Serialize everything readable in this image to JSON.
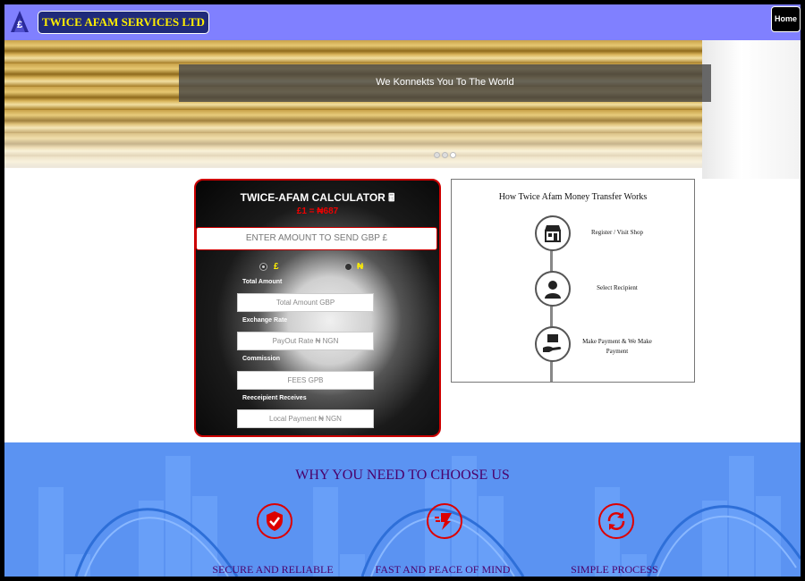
{
  "header": {
    "brand": "TWICE AFAM SERVICES LTD",
    "home_label": "Home",
    "logo_icon": "pound-logo-icon"
  },
  "hero": {
    "caption": "We Konnekts You To The World",
    "slide_count": 3,
    "active_slide": 3
  },
  "calculator": {
    "title": "TWICE-AFAM CALCULATOR 🖩",
    "rate": "£1 = ₦687",
    "amount_placeholder": "ENTER AMOUNT TO SEND GBP £",
    "currency_options": [
      "£",
      "₦"
    ],
    "selected_currency": "£",
    "fields": [
      {
        "label": "Total Amount",
        "placeholder": "Total Amount GBP"
      },
      {
        "label": "Exchange Rate",
        "placeholder": "PayOut Rate ₦ NGN"
      },
      {
        "label": "Commission",
        "placeholder": "FEES GPB"
      },
      {
        "label": "Reeceipient Receives",
        "placeholder": "Local Payment ₦ NGN"
      }
    ]
  },
  "how_it_works": {
    "title": "How Twice Afam Money Transfer Works",
    "steps": [
      {
        "label": "Register / Visit Shop",
        "icon": "shop-icon"
      },
      {
        "label": "Select Recipient",
        "icon": "person-icon"
      },
      {
        "label": "Make Payment & We Make Payment",
        "icon": "hand-payment-icon"
      }
    ]
  },
  "why": {
    "title": "WHY YOU NEED TO CHOOSE US",
    "features": [
      {
        "label": "SECURE AND RELIABLE",
        "icon": "shield-check-icon"
      },
      {
        "label": "FAST AND PEACE OF MIND",
        "icon": "fast-delivery-icon"
      },
      {
        "label": "SIMPLE PROCESS",
        "icon": "cycle-arrows-icon"
      }
    ]
  },
  "colors": {
    "header_bg": "#8080ff",
    "brand_bg": "#1f2a7a",
    "brand_text": "#ffef00",
    "accent_red": "#cc0000",
    "why_bg": "#5b93f2",
    "why_text": "#4a006a"
  }
}
